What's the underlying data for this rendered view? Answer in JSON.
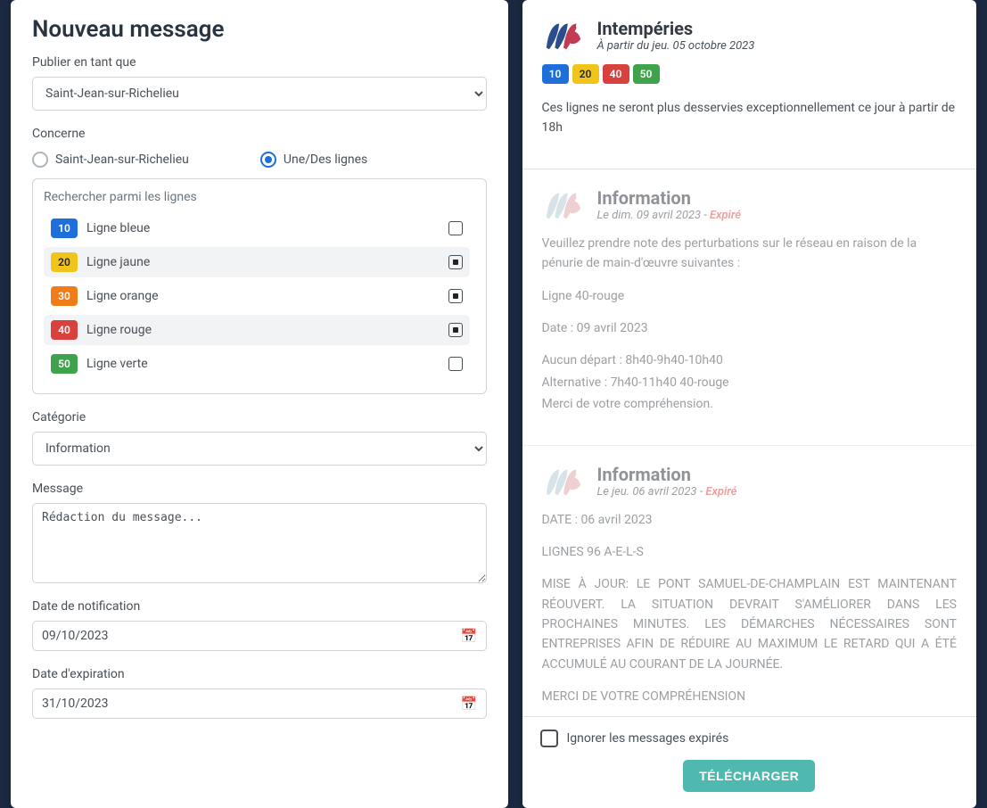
{
  "left": {
    "title": "Nouveau message",
    "publish_label": "Publier en tant que",
    "publish_value": "Saint-Jean-sur-Richelieu",
    "concerns_label": "Concerne",
    "radio_city": "Saint-Jean-sur-Richelieu",
    "radio_lines": "Une/Des lignes",
    "search_lines_hint": "Rechercher parmi les lignes",
    "lines": [
      {
        "num": "10",
        "name": "Ligne bleue",
        "color": "b-blue",
        "checked": false,
        "alt": false
      },
      {
        "num": "20",
        "name": "Ligne jaune",
        "color": "b-yellow",
        "checked": true,
        "alt": true
      },
      {
        "num": "30",
        "name": "Ligne orange",
        "color": "b-orange",
        "checked": true,
        "alt": false
      },
      {
        "num": "40",
        "name": "Ligne rouge",
        "color": "b-red",
        "checked": true,
        "alt": true
      },
      {
        "num": "50",
        "name": "Ligne verte",
        "color": "b-green",
        "checked": false,
        "alt": false
      }
    ],
    "category_label": "Catégorie",
    "category_value": "Information",
    "message_label": "Message",
    "message_value": "Rédaction du message...",
    "notif_date_label": "Date de notification",
    "notif_date_value": "09/10/2023",
    "exp_date_label": "Date d'expiration",
    "exp_date_value": "31/10/2023"
  },
  "right": {
    "messages": [
      {
        "title": "Intempéries",
        "date": "À partir du jeu. 05 octobre 2023",
        "expired": false,
        "badges": [
          {
            "num": "10",
            "color": "b-blue"
          },
          {
            "num": "20",
            "color": "b-yellow"
          },
          {
            "num": "40",
            "color": "b-red"
          },
          {
            "num": "50",
            "color": "b-green"
          }
        ],
        "body": [
          "Ces lignes ne seront plus desservies exceptionnellement ce jour à partir de 18h"
        ]
      },
      {
        "title": "Information",
        "date": "Le dim. 09 avril 2023",
        "expired": true,
        "expired_label": "Expiré",
        "badges": [],
        "body": [
          "Veuillez prendre note des perturbations sur le réseau en raison de la pénurie de main-d'œuvre suivantes :",
          "Ligne 40-rouge",
          "Date : 09 avril 2023",
          "Aucun départ : 8h40-9h40-10h40",
          "Alternative : 7h40-11h40 40-rouge",
          "Merci de votre compréhension."
        ],
        "body_tight": [
          3,
          4
        ]
      },
      {
        "title": "Information",
        "date": "Le jeu. 06 avril 2023",
        "expired": true,
        "expired_label": "Expiré",
        "badges": [],
        "body": [
          "DATE : 06 avril 2023",
          "LIGNES 96 A-E-L-S",
          "MISE À JOUR: LE PONT SAMUEL-DE-CHAMPLAIN EST MAINTENANT RÉOUVERT. LA SITUATION DEVRAIT S'AMÉLIORER DANS LES PROCHAINES MINUTES. LES DÉMARCHES NÉCESSAIRES SONT ENTREPRISES AFIN DE RÉDUIRE AU MAXIMUM LE RETARD QUI A ÉTÉ ACCUMULÉ AU COURANT DE LA JOURNÉE.",
          "MERCI DE VOTRE COMPRÉHENSION"
        ],
        "caps_idx": 2
      }
    ],
    "ignore_label": "Ignorer les messages expirés",
    "download_label": "TÉLÉCHARGER"
  }
}
